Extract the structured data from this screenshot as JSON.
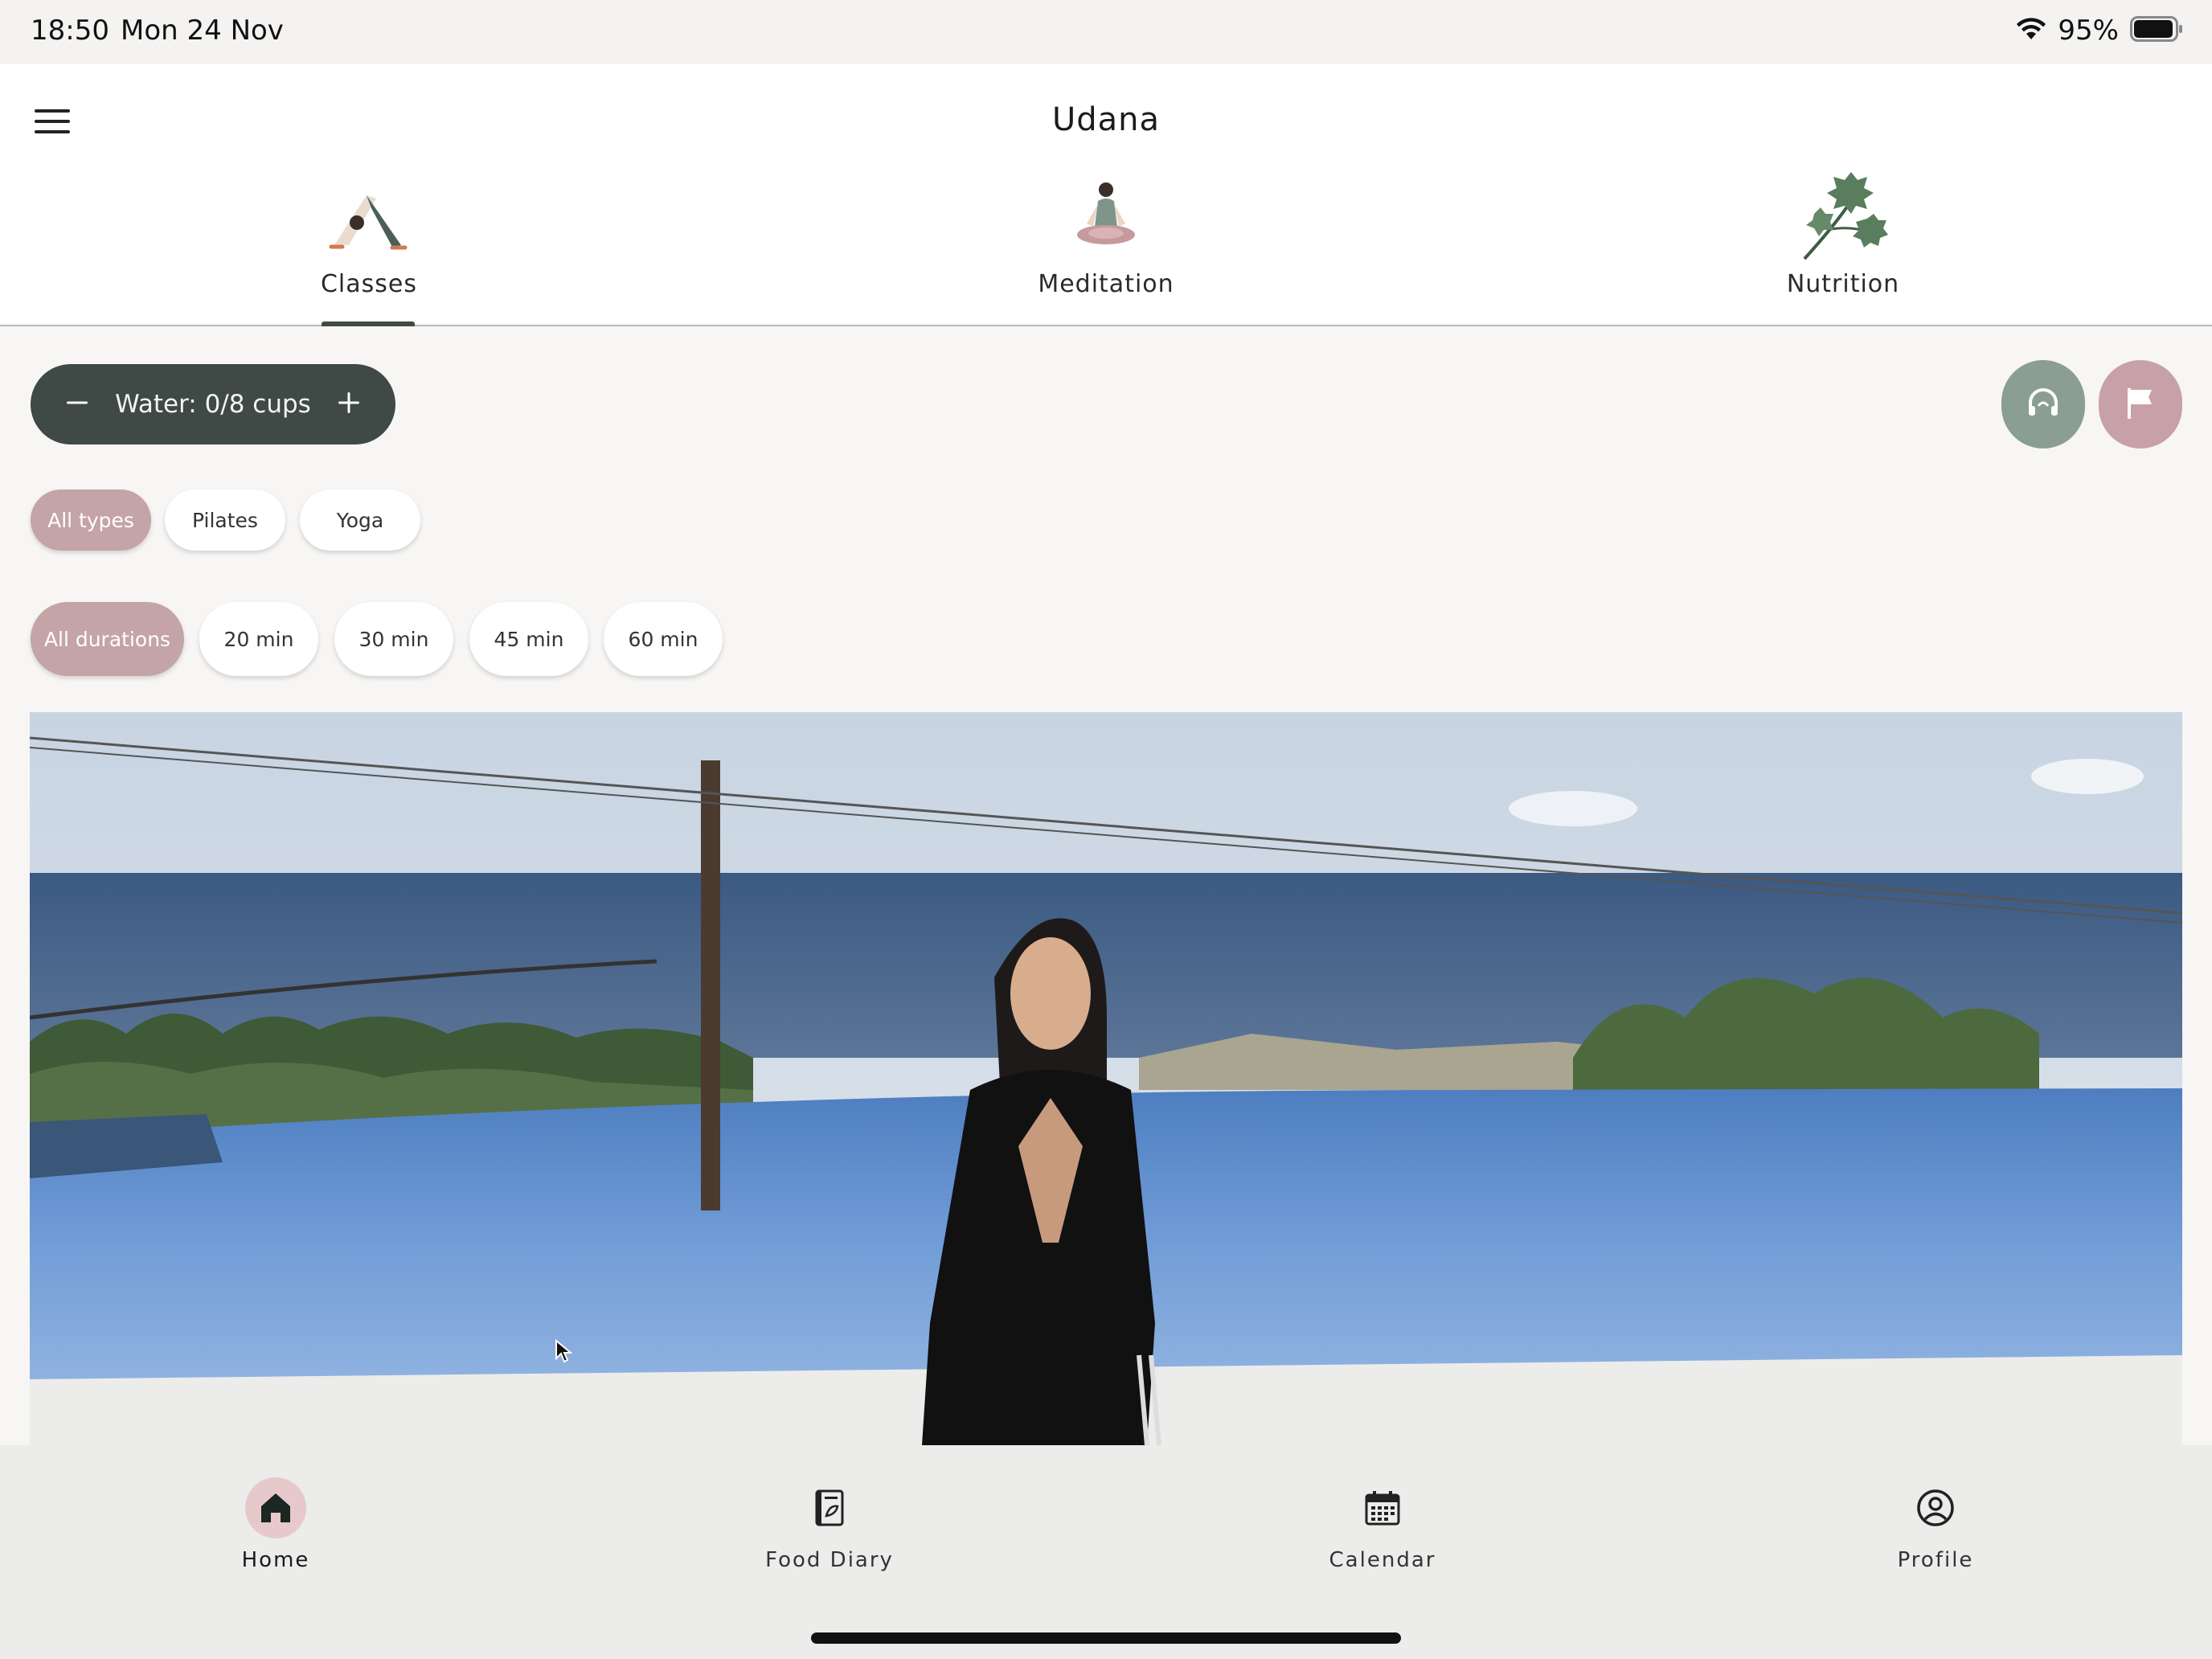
{
  "status_bar": {
    "time": "18:50",
    "date": "Mon 24 Nov",
    "battery": "95%",
    "icons": [
      "wifi-icon",
      "battery-icon"
    ]
  },
  "header": {
    "title": "Udana",
    "menu_icon": "hamburger-menu-icon"
  },
  "tabs": [
    {
      "label": "Classes",
      "icon": "yoga-downward-dog-icon",
      "selected": true
    },
    {
      "label": "Meditation",
      "icon": "meditation-lotus-icon",
      "selected": false
    },
    {
      "label": "Nutrition",
      "icon": "herb-leaf-icon",
      "selected": false
    }
  ],
  "water": {
    "label": "Water: 0/8 cups",
    "decrement_icon": "minus-icon",
    "increment_icon": "plus-icon"
  },
  "action_buttons": [
    {
      "icon": "headphones-icon",
      "color": "#8b9e93"
    },
    {
      "icon": "flag-icon",
      "color": "#c7a1a7"
    }
  ],
  "type_filters": [
    {
      "label": "All types",
      "selected": true
    },
    {
      "label": "Pilates",
      "selected": false
    },
    {
      "label": "Yoga",
      "selected": false
    }
  ],
  "duration_filters": [
    {
      "label": "All durations",
      "selected": true
    },
    {
      "label": "20 min",
      "selected": false
    },
    {
      "label": "30 min",
      "selected": false
    },
    {
      "label": "45 min",
      "selected": false
    },
    {
      "label": "60 min",
      "selected": false
    }
  ],
  "bottom_nav": [
    {
      "label": "Home",
      "icon": "home-icon",
      "selected": true
    },
    {
      "label": "Food Diary",
      "icon": "food-diary-icon",
      "selected": false
    },
    {
      "label": "Calendar",
      "icon": "calendar-icon",
      "selected": false
    },
    {
      "label": "Profile",
      "icon": "profile-icon",
      "selected": false
    }
  ],
  "colors": {
    "accent_dark": "#3f4945",
    "accent_pink": "#c4a4a7",
    "accent_green": "#8b9e93",
    "background": "#f7f6f4"
  }
}
